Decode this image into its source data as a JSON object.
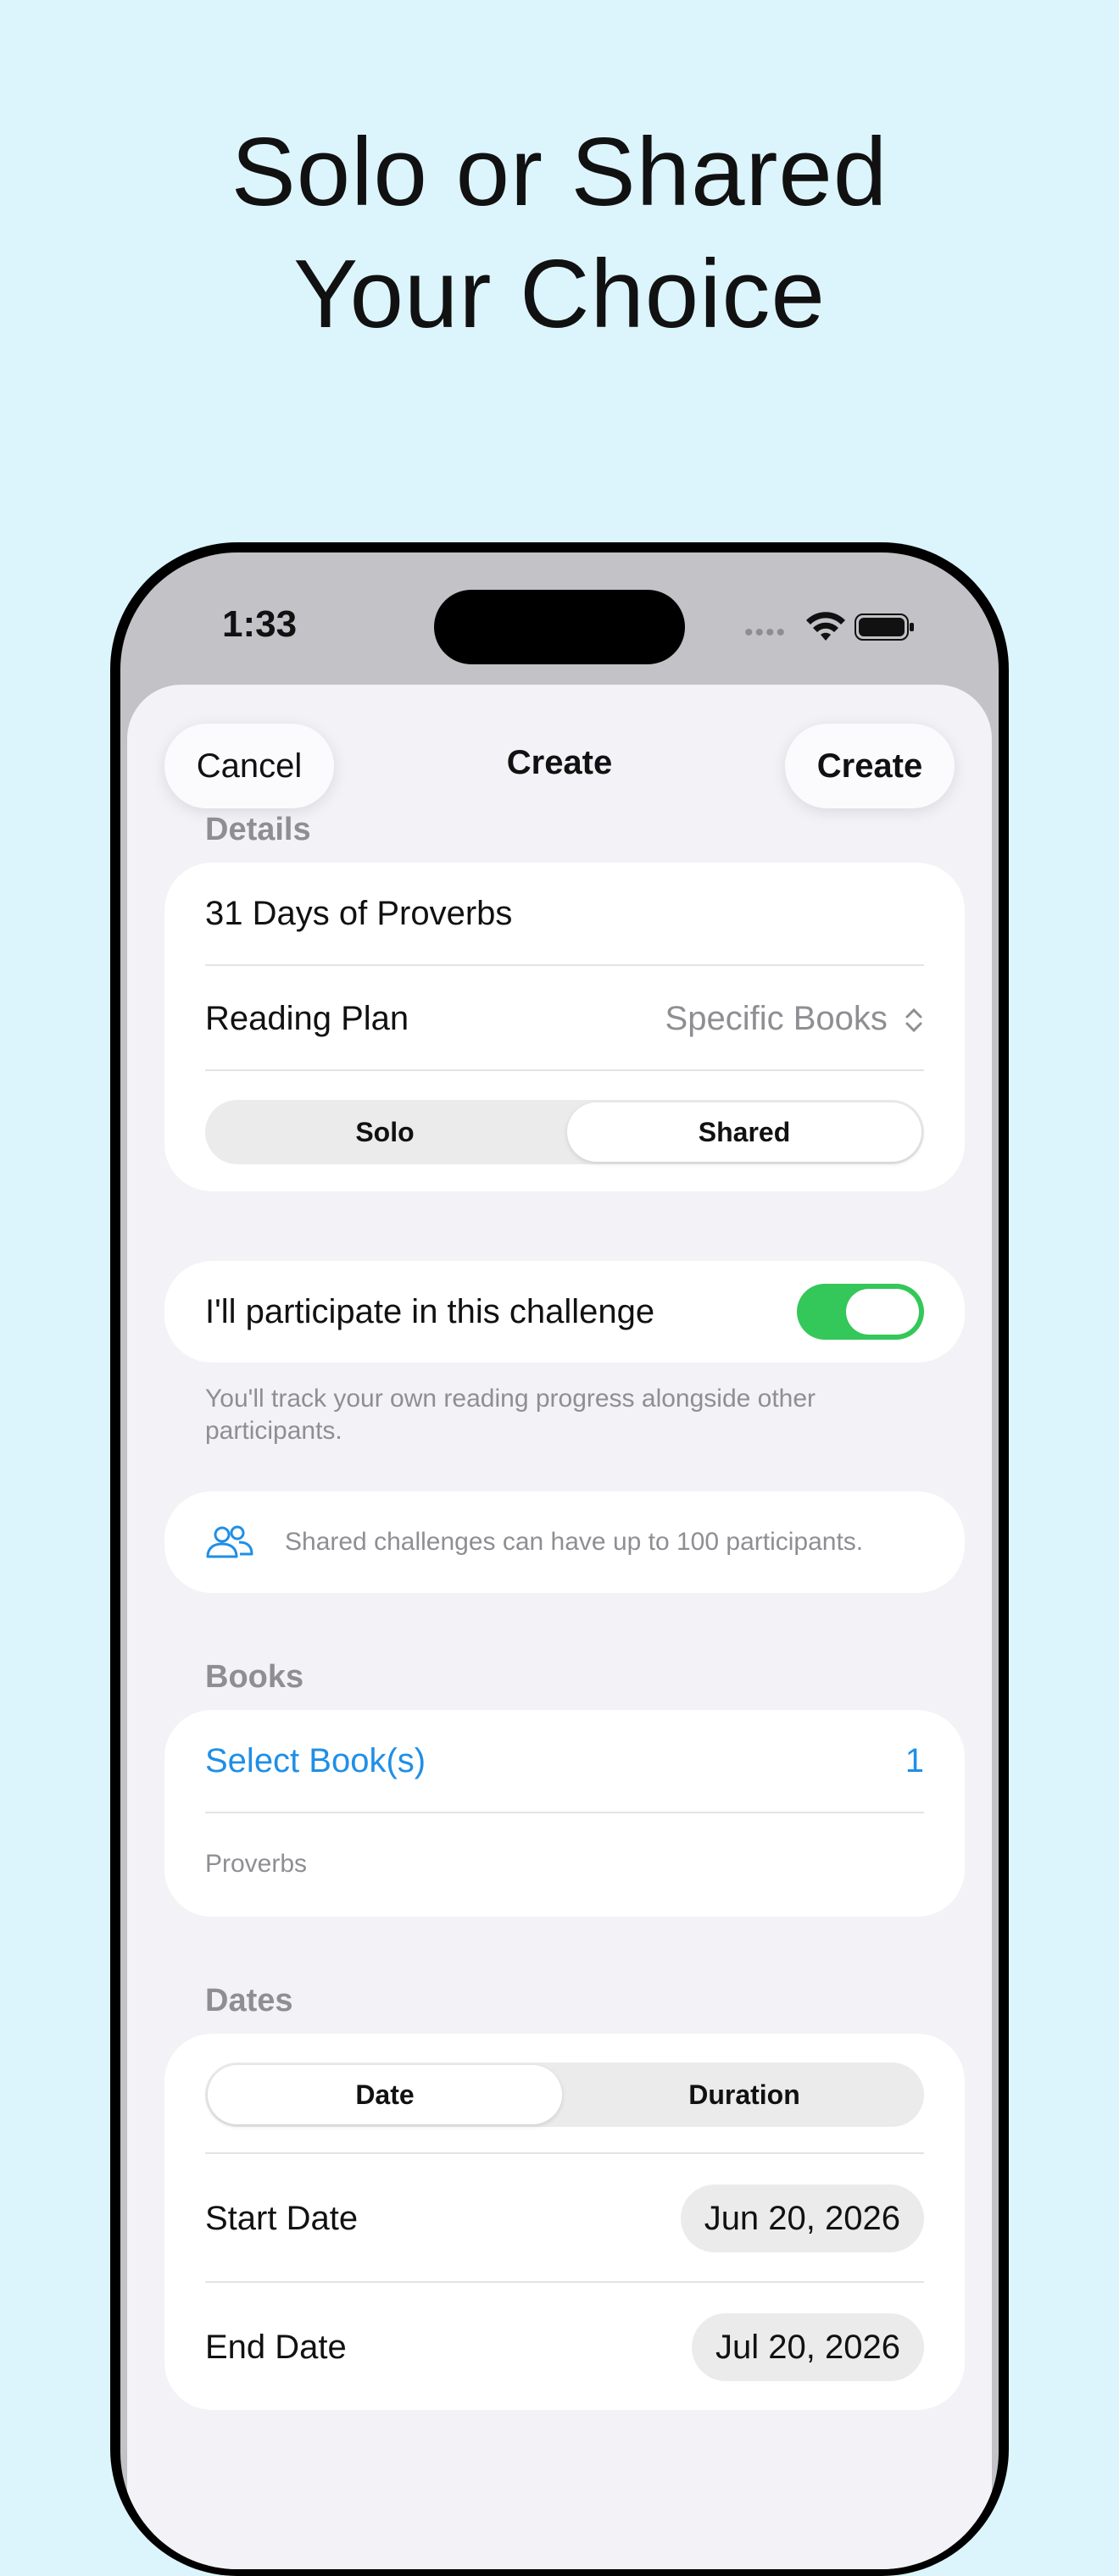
{
  "headline": {
    "line1": "Solo or Shared",
    "line2": "Your Choice"
  },
  "status_bar": {
    "time": "1:33",
    "signal": "••••"
  },
  "nav": {
    "cancel_label": "Cancel",
    "title": "Create",
    "create_label": "Create"
  },
  "details": {
    "section_label": "Details",
    "name_value": "31 Days of Proverbs",
    "reading_plan_label": "Reading Plan",
    "reading_plan_value": "Specific Books",
    "reading_plan_chevron": "⌃⌄",
    "mode_options": [
      "Solo",
      "Shared"
    ],
    "mode_selected": "Shared"
  },
  "participation": {
    "label": "I'll participate in this challenge",
    "enabled": true,
    "footnote": "You'll track your own reading progress alongside other participants."
  },
  "info_banner": {
    "icon": "people-icon",
    "text": "Shared challenges can have up to 100 participants."
  },
  "books": {
    "section_label": "Books",
    "select_label": "Select Book(s)",
    "count": "1",
    "selected_books": "Proverbs"
  },
  "dates": {
    "section_label": "Dates",
    "mode_options": [
      "Date",
      "Duration"
    ],
    "mode_selected": "Date",
    "start_label": "Start Date",
    "start_value": "Jun 20, 2026",
    "end_label": "End Date",
    "end_value": "Jul 20, 2026"
  },
  "colors": {
    "background": "#dcf4fc",
    "accent": "#1f8fe6",
    "toggle_on": "#34c759"
  }
}
